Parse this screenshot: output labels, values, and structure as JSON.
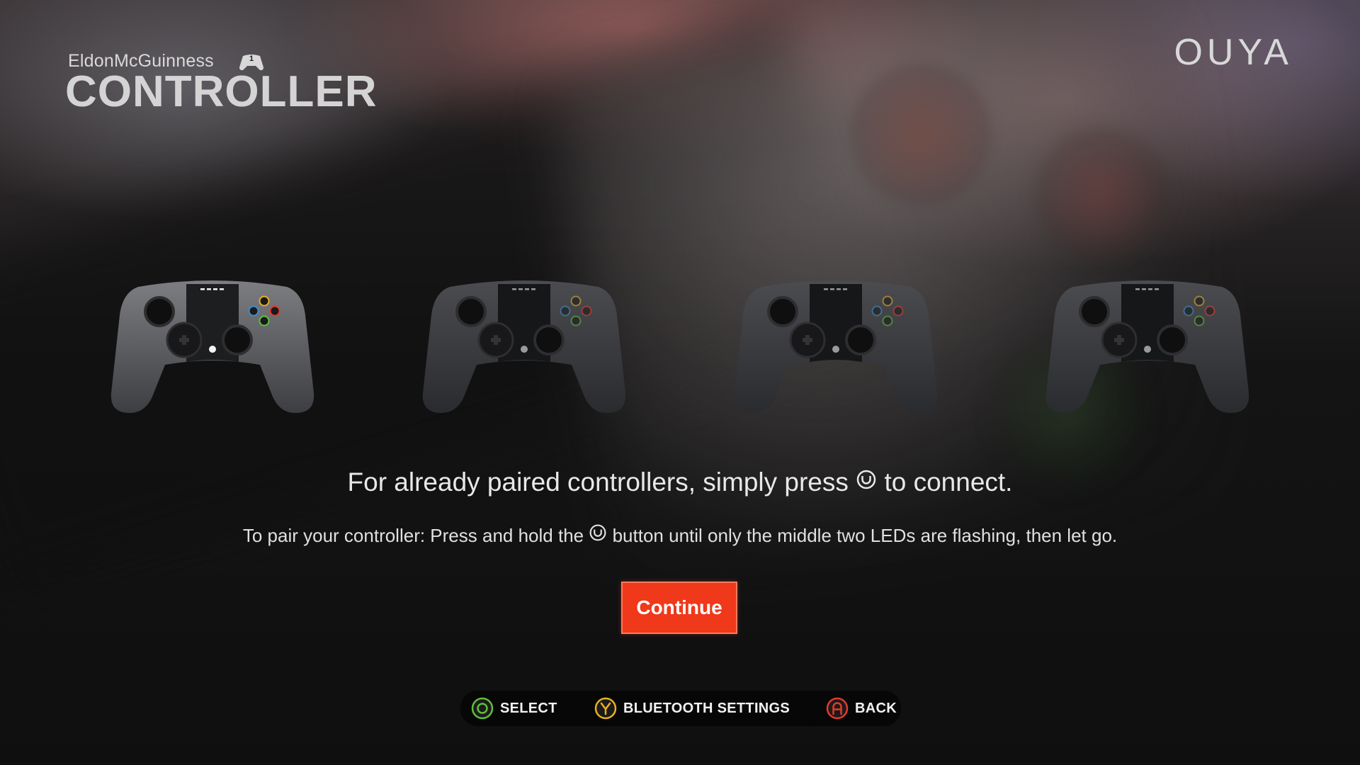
{
  "header": {
    "user_name": "EldonMcGuinness",
    "controller_number": "1",
    "title": "CONTROLLER",
    "brand": "OUYA"
  },
  "controllers": [
    {
      "slot": 1,
      "active": true
    },
    {
      "slot": 2,
      "active": false
    },
    {
      "slot": 3,
      "active": false
    },
    {
      "slot": 4,
      "active": false
    }
  ],
  "messages": {
    "primary_before": "For already paired controllers, simply press",
    "primary_after": "to connect.",
    "secondary_before": "To pair your controller: Press and hold the",
    "secondary_after": "button until only the middle two LEDs are flashing, then let go."
  },
  "continue_button": {
    "label": "Continue"
  },
  "footer_hints": [
    {
      "button": "O",
      "label": "SELECT",
      "color": "#5fbf3a"
    },
    {
      "button": "Y",
      "label": "BLUETOOTH SETTINGS",
      "color": "#e8b020"
    },
    {
      "button": "A",
      "label": "BACK",
      "color": "#e23a2a"
    }
  ],
  "colors": {
    "accent": "#f0381a",
    "o_button": "#5fbf3a",
    "u_button": "#3a8fd0",
    "y_button": "#e8b020",
    "a_button": "#e23a2a"
  },
  "icons": {
    "system_button": "ouya-system-button-icon",
    "brand": "ouya-logo"
  }
}
